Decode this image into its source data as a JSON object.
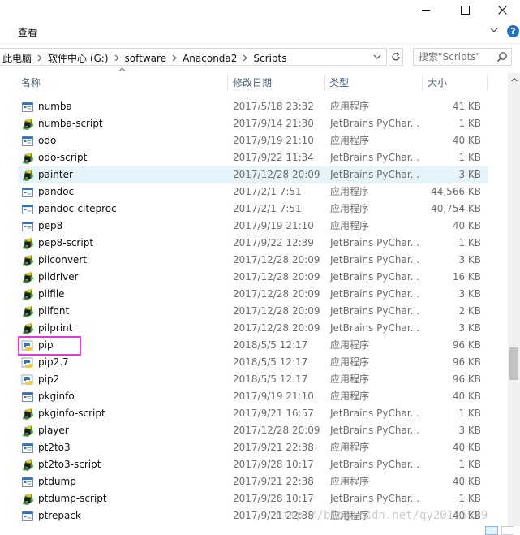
{
  "ribbon": {
    "tab_view": "查看"
  },
  "address": {
    "crumbs": [
      "此电脑",
      "软件中心 (G:)",
      "software",
      "Anaconda2",
      "Scripts"
    ]
  },
  "search": {
    "placeholder": "搜索\"Scripts\""
  },
  "columns": {
    "name": "名称",
    "date": "修改日期",
    "type": "类型",
    "size": "大小"
  },
  "files": [
    {
      "name": "numba",
      "date": "2017/5/18 23:32",
      "type": "应用程序",
      "size": "41 KB",
      "icon": "exe-icon"
    },
    {
      "name": "numba-script",
      "date": "2017/9/14 21:30",
      "type": "JetBrains PyChar...",
      "size": "1 KB",
      "icon": "pycharm-file-icon"
    },
    {
      "name": "odo",
      "date": "2017/9/19 21:10",
      "type": "应用程序",
      "size": "40 KB",
      "icon": "exe-icon"
    },
    {
      "name": "odo-script",
      "date": "2017/9/22 11:34",
      "type": "JetBrains PyChar...",
      "size": "1 KB",
      "icon": "pycharm-file-icon"
    },
    {
      "name": "painter",
      "date": "2017/12/28 20:09",
      "type": "JetBrains PyChar...",
      "size": "3 KB",
      "icon": "pycharm-file-icon",
      "selected": true
    },
    {
      "name": "pandoc",
      "date": "2017/2/1 7:51",
      "type": "应用程序",
      "size": "44,566 KB",
      "icon": "exe-icon"
    },
    {
      "name": "pandoc-citeproc",
      "date": "2017/2/1 7:51",
      "type": "应用程序",
      "size": "40,754 KB",
      "icon": "exe-icon"
    },
    {
      "name": "pep8",
      "date": "2017/9/19 21:10",
      "type": "应用程序",
      "size": "40 KB",
      "icon": "exe-icon"
    },
    {
      "name": "pep8-script",
      "date": "2017/9/22 12:39",
      "type": "JetBrains PyChar...",
      "size": "1 KB",
      "icon": "pycharm-file-icon"
    },
    {
      "name": "pilconvert",
      "date": "2017/12/28 20:09",
      "type": "JetBrains PyChar...",
      "size": "3 KB",
      "icon": "pycharm-file-icon"
    },
    {
      "name": "pildriver",
      "date": "2017/12/28 20:09",
      "type": "JetBrains PyChar...",
      "size": "16 KB",
      "icon": "pycharm-file-icon"
    },
    {
      "name": "pilfile",
      "date": "2017/12/28 20:09",
      "type": "JetBrains PyChar...",
      "size": "3 KB",
      "icon": "pycharm-file-icon"
    },
    {
      "name": "pilfont",
      "date": "2017/12/28 20:09",
      "type": "JetBrains PyChar...",
      "size": "2 KB",
      "icon": "pycharm-file-icon"
    },
    {
      "name": "pilprint",
      "date": "2017/12/28 20:09",
      "type": "JetBrains PyChar...",
      "size": "3 KB",
      "icon": "pycharm-file-icon"
    },
    {
      "name": "pip",
      "date": "2018/5/5 12:17",
      "type": "应用程序",
      "size": "96 KB",
      "icon": "python-exe-icon"
    },
    {
      "name": "pip2.7",
      "date": "2018/5/5 12:17",
      "type": "应用程序",
      "size": "96 KB",
      "icon": "python-exe-icon"
    },
    {
      "name": "pip2",
      "date": "2018/5/5 12:17",
      "type": "应用程序",
      "size": "96 KB",
      "icon": "python-exe-icon"
    },
    {
      "name": "pkginfo",
      "date": "2017/9/19 21:10",
      "type": "应用程序",
      "size": "40 KB",
      "icon": "exe-icon"
    },
    {
      "name": "pkginfo-script",
      "date": "2017/9/21 16:57",
      "type": "JetBrains PyChar...",
      "size": "1 KB",
      "icon": "pycharm-file-icon"
    },
    {
      "name": "player",
      "date": "2017/12/28 20:09",
      "type": "JetBrains PyChar...",
      "size": "3 KB",
      "icon": "pycharm-file-icon"
    },
    {
      "name": "pt2to3",
      "date": "2017/9/21 22:38",
      "type": "应用程序",
      "size": "40 KB",
      "icon": "exe-icon"
    },
    {
      "name": "pt2to3-script",
      "date": "2017/9/28 10:17",
      "type": "JetBrains PyChar...",
      "size": "1 KB",
      "icon": "pycharm-file-icon"
    },
    {
      "name": "ptdump",
      "date": "2017/9/21 22:38",
      "type": "应用程序",
      "size": "40 KB",
      "icon": "exe-icon"
    },
    {
      "name": "ptdump-script",
      "date": "2017/9/28 10:17",
      "type": "JetBrains PyChar...",
      "size": "1 KB",
      "icon": "pycharm-file-icon"
    },
    {
      "name": "ptrepack",
      "date": "2017/9/21 22:38",
      "type": "应用程序",
      "size": "40 KB",
      "icon": "exe-icon"
    }
  ],
  "watermark": "http://blog.csdn.net/qy20115549",
  "colors": {
    "selected_row": "#e5f3fb",
    "highlight_box": "#e23ad9",
    "header_text": "#4c607a"
  }
}
